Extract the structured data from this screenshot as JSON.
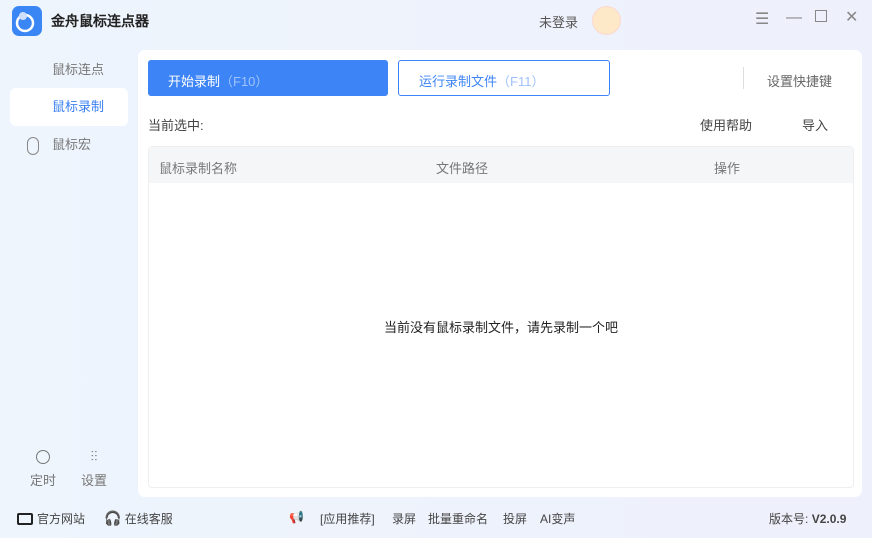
{
  "app": {
    "title": "金舟鼠标连点器",
    "login": "未登录"
  },
  "sidebar": {
    "items": [
      {
        "label": "鼠标连点"
      },
      {
        "label": "鼠标录制"
      },
      {
        "label": "鼠标宏"
      }
    ],
    "timer": "定时",
    "settings": "设置"
  },
  "toolbar": {
    "start_record": "开始录制",
    "start_key": "（F10）",
    "run_file": "运行录制文件",
    "run_key": "（F11）",
    "shortcut": "设置快捷键"
  },
  "selection": {
    "label": "当前选中:",
    "help": "使用帮助",
    "import": "导入"
  },
  "table": {
    "columns": [
      "鼠标录制名称",
      "文件路径",
      "操作"
    ],
    "empty": "当前没有鼠标录制文件，请先录制一个吧"
  },
  "footer": {
    "website": "官方网站",
    "support": "在线客服",
    "recommend": "[应用推荐]",
    "apps": [
      "录屏",
      "批量重命名",
      "投屏",
      "AI变声"
    ],
    "version_label": "版本号:",
    "version": "V2.0.9"
  },
  "colors": {
    "accent": "#3d85f6"
  }
}
